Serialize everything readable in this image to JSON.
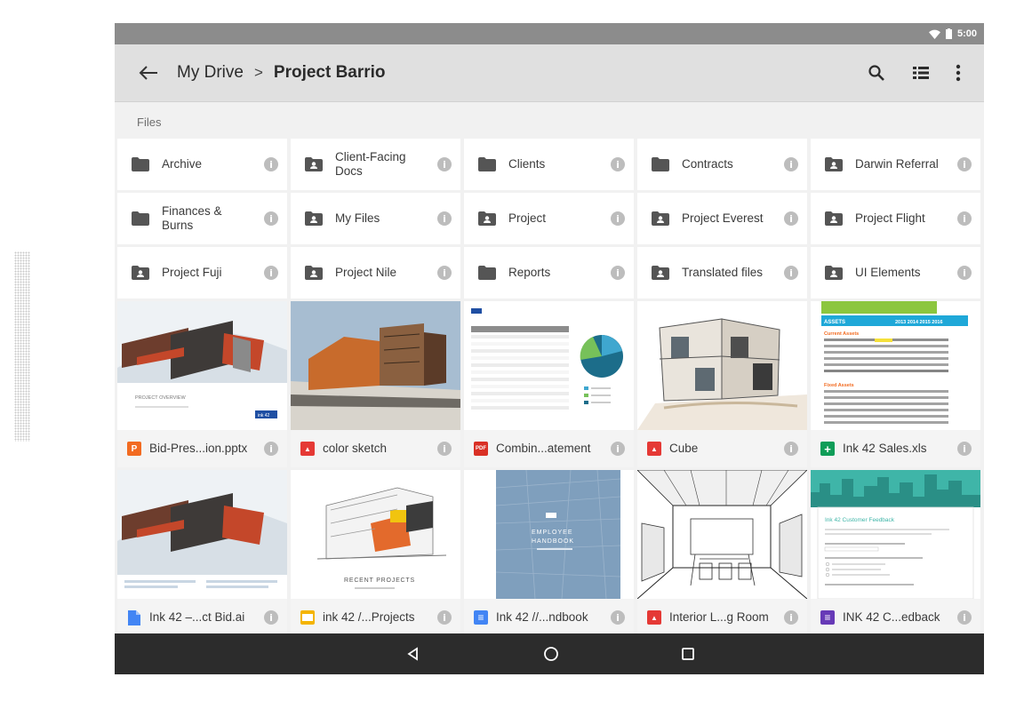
{
  "status": {
    "time": "5:00"
  },
  "appbar": {
    "crumb_root": "My Drive",
    "crumb_sep": ">",
    "crumb_current": "Project Barrio"
  },
  "section_label": "Files",
  "folders": [
    {
      "name": "Archive",
      "shared": false
    },
    {
      "name": "Client-Facing Docs",
      "shared": true
    },
    {
      "name": "Clients",
      "shared": false
    },
    {
      "name": "Contracts",
      "shared": false
    },
    {
      "name": "Darwin Referral",
      "shared": true
    },
    {
      "name": "Finances & Burns",
      "shared": false
    },
    {
      "name": "My Files",
      "shared": true
    },
    {
      "name": "Project",
      "shared": true
    },
    {
      "name": "Project Everest",
      "shared": true
    },
    {
      "name": "Project Flight",
      "shared": true
    },
    {
      "name": "Project Fuji",
      "shared": true
    },
    {
      "name": "Project Nile",
      "shared": true
    },
    {
      "name": "Reports",
      "shared": false
    },
    {
      "name": "Translated files",
      "shared": true
    },
    {
      "name": "UI Elements",
      "shared": true
    }
  ],
  "files": [
    {
      "name": "Bid-Pres...ion.pptx",
      "type": "slides-pptx",
      "badge": "P",
      "color": "#f26b21"
    },
    {
      "name": "color sketch",
      "type": "image",
      "badge": "▲",
      "color": "#e53935"
    },
    {
      "name": "Combin...atement",
      "type": "pdf",
      "badge": "PDF",
      "color": "#d93025"
    },
    {
      "name": "Cube",
      "type": "image",
      "badge": "▲",
      "color": "#e53935"
    },
    {
      "name": "Ink 42 Sales.xls",
      "type": "sheets",
      "badge": "+",
      "color": "#0f9d58"
    },
    {
      "name": "Ink 42 –...ct Bid.ai",
      "type": "doc-file",
      "badge": "",
      "color": "#4285f4"
    },
    {
      "name": "ink 42 /...Projects",
      "type": "slides",
      "badge": "",
      "color": "#f4b400"
    },
    {
      "name": "Ink 42 //...ndbook",
      "type": "docs",
      "badge": "≡",
      "color": "#4285f4"
    },
    {
      "name": "Interior L...g Room",
      "type": "image",
      "badge": "▲",
      "color": "#e53935"
    },
    {
      "name": "INK 42 C...edback",
      "type": "forms",
      "badge": "≡",
      "color": "#673ab7"
    }
  ],
  "thumbs": {
    "bid_pres_caption": "PROJECT OVERVIEW",
    "bid_pres_logo": "ink 42",
    "sales_header": "ASSETS",
    "sales_years": "2013 2014 2015 2016",
    "sales_current": "Current Assets",
    "sales_fixed": "Fixed Assets",
    "handbook_line1": "EMPLOYEE",
    "handbook_line2": "HANDBOOK",
    "recent_projects": "RECENT PROJECTS",
    "feedback_title": "Ink 42 Customer Feedback"
  }
}
